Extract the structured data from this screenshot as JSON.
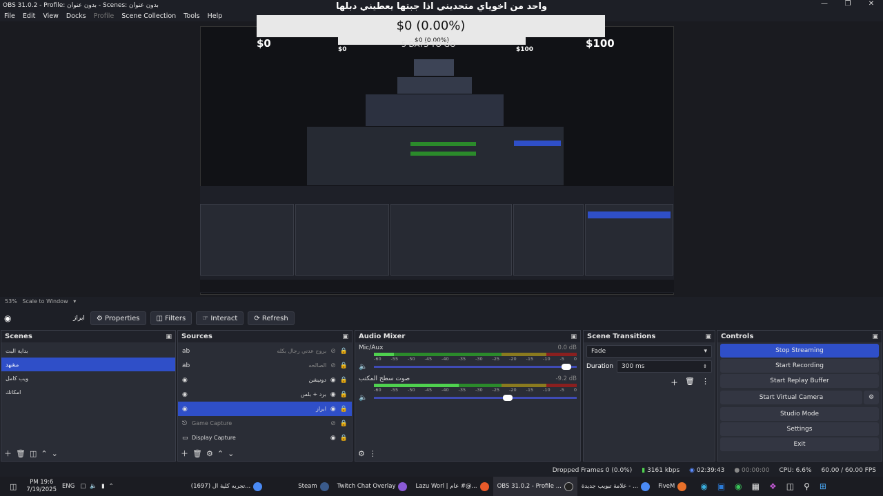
{
  "window": {
    "title": "OBS 31.0.2 - Profile: بدون عنوان - Scenes: بدون عنوان",
    "overlay_text": "واحد من اخوياي متحديني اذا جبتها يعطيني دبلها"
  },
  "menu": [
    "File",
    "Edit",
    "View",
    "Docks",
    "Profile",
    "Scene Collection",
    "Tools",
    "Help"
  ],
  "donation": {
    "amount": "$0 (0.00%)",
    "min": "$0",
    "max": "$100",
    "sub": "5 DAYS TO GO"
  },
  "nested": {
    "amount": "$0 (0.00%)"
  },
  "zoom": {
    "percent": "53%",
    "mode": "Scale to Window"
  },
  "toolbar": {
    "current_source": "ابراز",
    "properties": "Properties",
    "filters": "Filters",
    "interact": "Interact",
    "refresh": "Refresh"
  },
  "scenes": {
    "title": "Scenes",
    "items": [
      "بداية البث",
      "مشهد",
      "ويب كامل",
      "امكانك"
    ],
    "selected": 1
  },
  "sources": {
    "title": "Sources",
    "items": [
      {
        "icon": "ab",
        "name": "بروح عدني رجال بكله",
        "dim": true
      },
      {
        "icon": "ab",
        "name": "الصالحه",
        "dim": true
      },
      {
        "icon": "globe",
        "name": "دونيشن",
        "dim": false
      },
      {
        "icon": "globe",
        "name": "برد + بلس",
        "dim": false
      },
      {
        "icon": "globe",
        "name": "ابراز",
        "dim": false,
        "selected": true
      },
      {
        "icon": "gamepad",
        "name": "Game Capture",
        "dim": true
      },
      {
        "icon": "monitor",
        "name": "Display Capture",
        "dim": false
      }
    ]
  },
  "mixer": {
    "title": "Audio Mixer",
    "tracks": [
      {
        "name": "Mic/Aux",
        "db": "0.0 dB",
        "level": 0.05,
        "volume": 0.95
      },
      {
        "name": "صوت سطح المكتب",
        "db": "-9.2 dB",
        "level": 0.42,
        "volume": 0.66
      }
    ],
    "ticks": [
      "-60",
      "-55",
      "-50",
      "-45",
      "-40",
      "-35",
      "-30",
      "-25",
      "-20",
      "-15",
      "-10",
      "-5",
      "0"
    ]
  },
  "transitions": {
    "title": "Scene Transitions",
    "type": "Fade",
    "duration_label": "Duration",
    "duration": "300 ms"
  },
  "controls": {
    "title": "Controls",
    "buttons": [
      "Stop Streaming",
      "Start Recording",
      "Start Replay Buffer",
      "Start Virtual Camera",
      "Studio Mode",
      "Settings",
      "Exit"
    ]
  },
  "status": {
    "dropped": "Dropped Frames 0 (0.0%)",
    "kbps": "3161 kbps",
    "live": "02:39:43",
    "rec": "00:00:00",
    "cpu": "CPU: 6.6%",
    "fps": "60.00 / 60.00 FPS"
  },
  "taskbar": {
    "time": "PM 19:6",
    "date": "7/19/2025",
    "lang": "ENG",
    "apps": [
      "(1697) تجربه كلية ال...",
      "Steam",
      "Twitch Chat Overlay",
      "Lazu Worl | عام #@...",
      "OBS 31.0.2 - Profile ...",
      "علامة تبويب جديدة - ...",
      "FiveM"
    ]
  },
  "colors": {
    "accent": "#2f4fc8",
    "bg": "#1d1f26"
  }
}
